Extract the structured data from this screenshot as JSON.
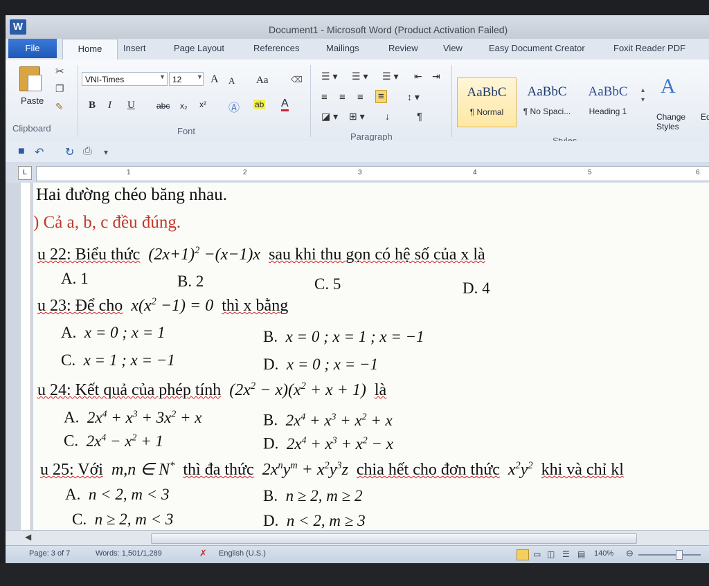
{
  "window": {
    "app_icon": "W",
    "title": "Document1 - Microsoft Word (Product Activation Failed)"
  },
  "tabs": [
    "File",
    "Home",
    "Insert",
    "Page Layout",
    "References",
    "Mailings",
    "Review",
    "View",
    "Easy Document Creator",
    "Foxit Reader PDF"
  ],
  "ribbon": {
    "clipboard": {
      "paste": "Paste",
      "label": "Clipboard"
    },
    "font": {
      "family": "VNI-Times",
      "size": "12",
      "label": "Font",
      "grow": "A",
      "shrink": "A",
      "case": "Aa",
      "bold": "B",
      "italic": "I",
      "underline": "U",
      "strike": "abc",
      "subscript": "x₂",
      "superscript": "x²",
      "highlight": "ab",
      "font_color": "A"
    },
    "paragraph": {
      "label": "Paragraph",
      "pilcrow": "¶"
    },
    "styles": {
      "label": "Styles",
      "items": [
        {
          "sample": "AaBbC",
          "name": "¶ Normal"
        },
        {
          "sample": "AaBbC",
          "name": "¶ No Spaci..."
        },
        {
          "sample": "AaBbC",
          "name": "Heading 1"
        }
      ],
      "change_styles": "Change Styles",
      "editing_partial": "Ed"
    }
  },
  "ruler": {
    "tab_selector": "L",
    "numbers": [
      "1",
      "2",
      "3",
      "4",
      "5",
      "6"
    ]
  },
  "document": {
    "line1": "Hai đường chéo băng nhau.",
    "line2": ") Cả a, b, c đều đúng.",
    "q22": {
      "prefix": "u 22: Biểu thức",
      "suffix": "sau khi thu gọn có hệ số của x là",
      "answers": [
        "A. 1",
        "B. 2",
        "C. 5",
        "D. 4"
      ]
    },
    "q23": {
      "prefix": "u 23: Để cho",
      "suffix": "thì x bằng",
      "letters": [
        "A.",
        "B.",
        "C.",
        "D."
      ]
    },
    "q24": {
      "prefix": "u 24: Kết quả của phép tính",
      "suffix": "là",
      "letters": [
        "A.",
        "B.",
        "C.",
        "D."
      ]
    },
    "q25": {
      "prefix": "u 25: Với",
      "mid1": "thì đa thức",
      "mid2": "chia hết cho đơn thức",
      "suffix": "khi và chỉ kl",
      "letters": [
        "A.",
        "B.",
        "C.",
        "D."
      ]
    }
  },
  "status": {
    "page": "Page: 3 of 7",
    "words": "Words: 1,501/1,289",
    "language": "English (U.S.)",
    "zoom": "140%"
  }
}
